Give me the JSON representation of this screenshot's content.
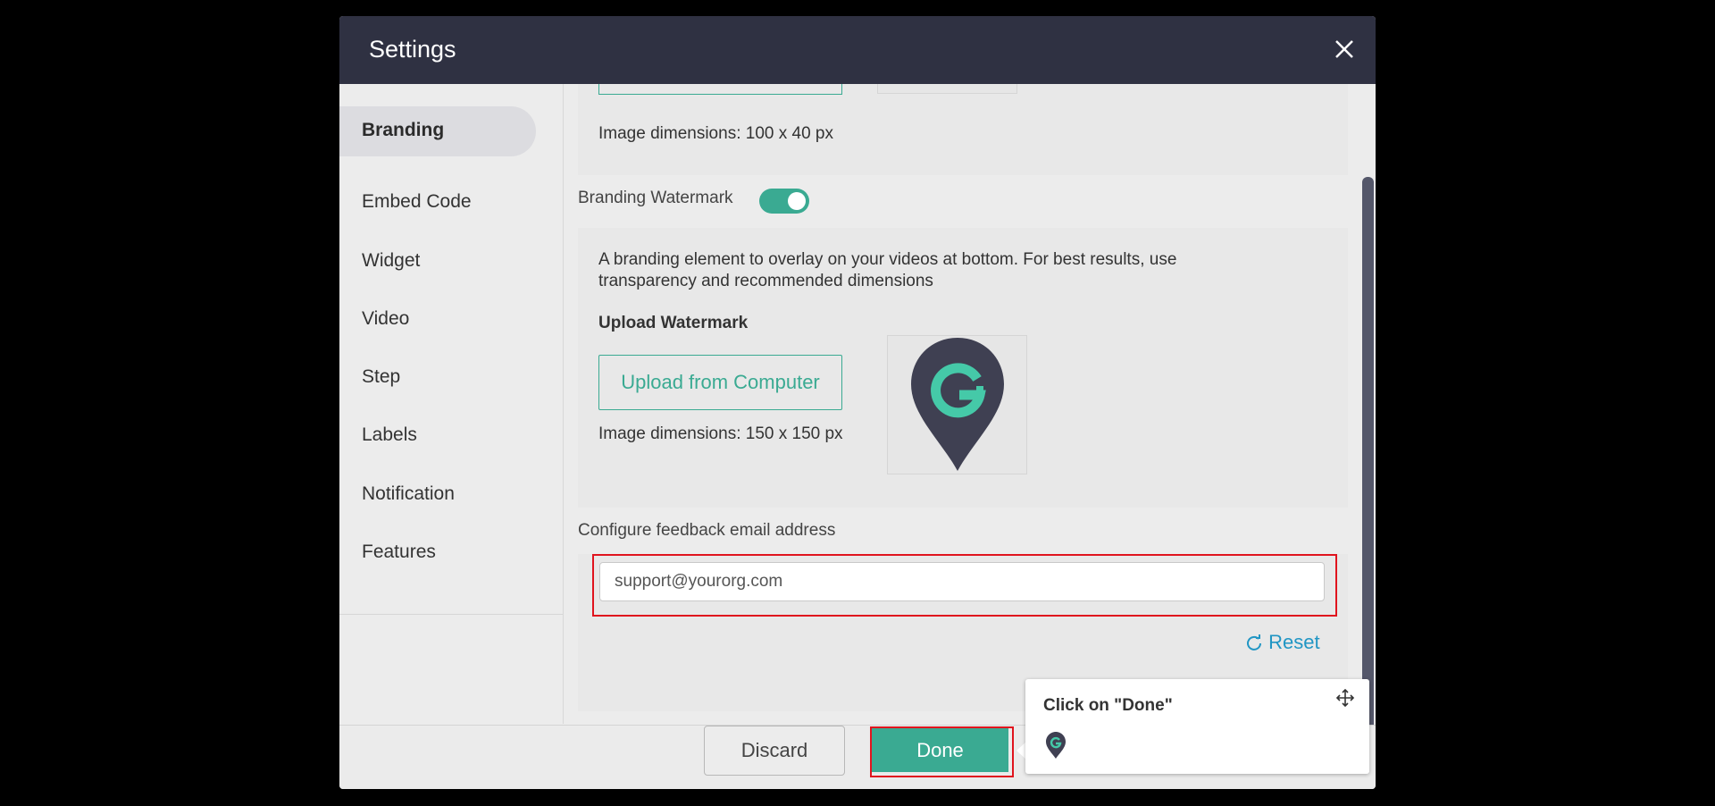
{
  "dialog": {
    "title": "Settings"
  },
  "sidebar": {
    "items": [
      {
        "label": "Branding"
      },
      {
        "label": "Embed Code"
      },
      {
        "label": "Widget"
      },
      {
        "label": "Video"
      },
      {
        "label": "Step"
      },
      {
        "label": "Labels"
      },
      {
        "label": "Notification"
      },
      {
        "label": "Features"
      }
    ]
  },
  "branding": {
    "logo_dimensions": "Image dimensions: 100 x 40 px",
    "watermark_label": "Branding Watermark",
    "watermark_enabled": true,
    "watermark_description": "A branding element to overlay on your videos at bottom. For best results, use transparency and recommended dimensions",
    "upload_watermark_heading": "Upload Watermark",
    "upload_button_label": "Upload from Computer",
    "watermark_dimensions": "Image dimensions: 150 x 150 px",
    "watermark_preview_icon": "map-pin-g-logo",
    "feedback_email_label": "Configure feedback email address",
    "feedback_email_value": "support@yourorg.com",
    "reset_label": "Reset"
  },
  "footer": {
    "discard_label": "Discard",
    "done_label": "Done"
  },
  "tooltip": {
    "text": "Click on \"Done\"",
    "move_icon": "move-icon",
    "logo_icon": "map-pin-g-logo"
  },
  "colors": {
    "header_bg": "#2f3142",
    "accent": "#3aaa92",
    "highlight_border": "#e0141e",
    "link": "#2196c4"
  }
}
